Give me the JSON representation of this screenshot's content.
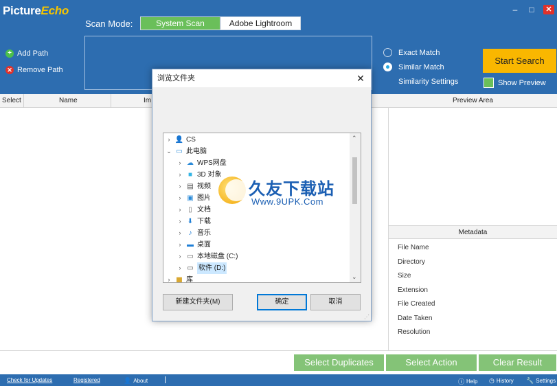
{
  "app": {
    "logo_picture": "Picture",
    "logo_echo": "Echo",
    "minimize": "–",
    "maximize": "□",
    "close": "✕"
  },
  "scan": {
    "label": "Scan Mode:",
    "tabs": [
      {
        "label": "System Scan",
        "active": true
      },
      {
        "label": "Adobe Lightroom",
        "active": false
      }
    ]
  },
  "paths": {
    "add_label": "Add Path",
    "remove_label": "Remove Path"
  },
  "match": {
    "exact_label": "Exact Match",
    "similar_label": "Similar Match",
    "selected": "similar",
    "settings_label": "Similarity Settings"
  },
  "search": {
    "start_label": "Start Search",
    "show_preview_label": "Show Preview",
    "show_preview_checked": true
  },
  "table": {
    "columns": [
      "Select",
      "Name",
      "Im"
    ]
  },
  "preview": {
    "title": "Preview Area"
  },
  "metadata": {
    "title": "Metadata",
    "fields": [
      "File Name",
      "Directory",
      "Size",
      "Extension",
      "File Created",
      "Date Taken",
      "Resolution"
    ]
  },
  "actions": {
    "select_duplicates": "Select Duplicates",
    "select_action": "Select Action",
    "clear_result": "Clear Result"
  },
  "status": {
    "check_updates": "Check for Updates",
    "registered": "Registered",
    "about": "About",
    "help": "Help",
    "history": "History",
    "settings": "Settings"
  },
  "dialog": {
    "title": "浏览文件夹",
    "close": "✕",
    "tree": [
      {
        "label": "CS",
        "expanded": false,
        "level": 0,
        "icon": "user-icon"
      },
      {
        "label": "此电脑",
        "expanded": true,
        "level": 0,
        "icon": "computer-icon"
      },
      {
        "label": "WPS网盘",
        "expanded": false,
        "level": 1,
        "icon": "cloud-icon"
      },
      {
        "label": "3D 对象",
        "expanded": false,
        "level": 1,
        "icon": "cube-icon"
      },
      {
        "label": "视频",
        "expanded": false,
        "level": 1,
        "icon": "video-icon"
      },
      {
        "label": "图片",
        "expanded": false,
        "level": 1,
        "icon": "picture-icon"
      },
      {
        "label": "文档",
        "expanded": false,
        "level": 1,
        "icon": "document-icon"
      },
      {
        "label": "下载",
        "expanded": false,
        "level": 1,
        "icon": "download-icon"
      },
      {
        "label": "音乐",
        "expanded": false,
        "level": 1,
        "icon": "music-icon"
      },
      {
        "label": "桌面",
        "expanded": false,
        "level": 1,
        "icon": "desktop-icon"
      },
      {
        "label": "本地磁盘 (C:)",
        "expanded": false,
        "level": 1,
        "icon": "drive-icon"
      },
      {
        "label": "软件 (D:)",
        "expanded": false,
        "level": 1,
        "icon": "drive-icon",
        "selected": true
      },
      {
        "label": "库",
        "expanded": false,
        "level": 0,
        "icon": "library-icon"
      }
    ],
    "new_folder": "新建文件夹(M)",
    "ok": "确定",
    "cancel": "取消"
  },
  "watermark": {
    "cn": "久友下载站",
    "url": "Www.9UPK.Com"
  },
  "colors": {
    "header_blue": "#2d6db0",
    "accent_green": "#84c377",
    "start_yellow": "#f9b700"
  }
}
